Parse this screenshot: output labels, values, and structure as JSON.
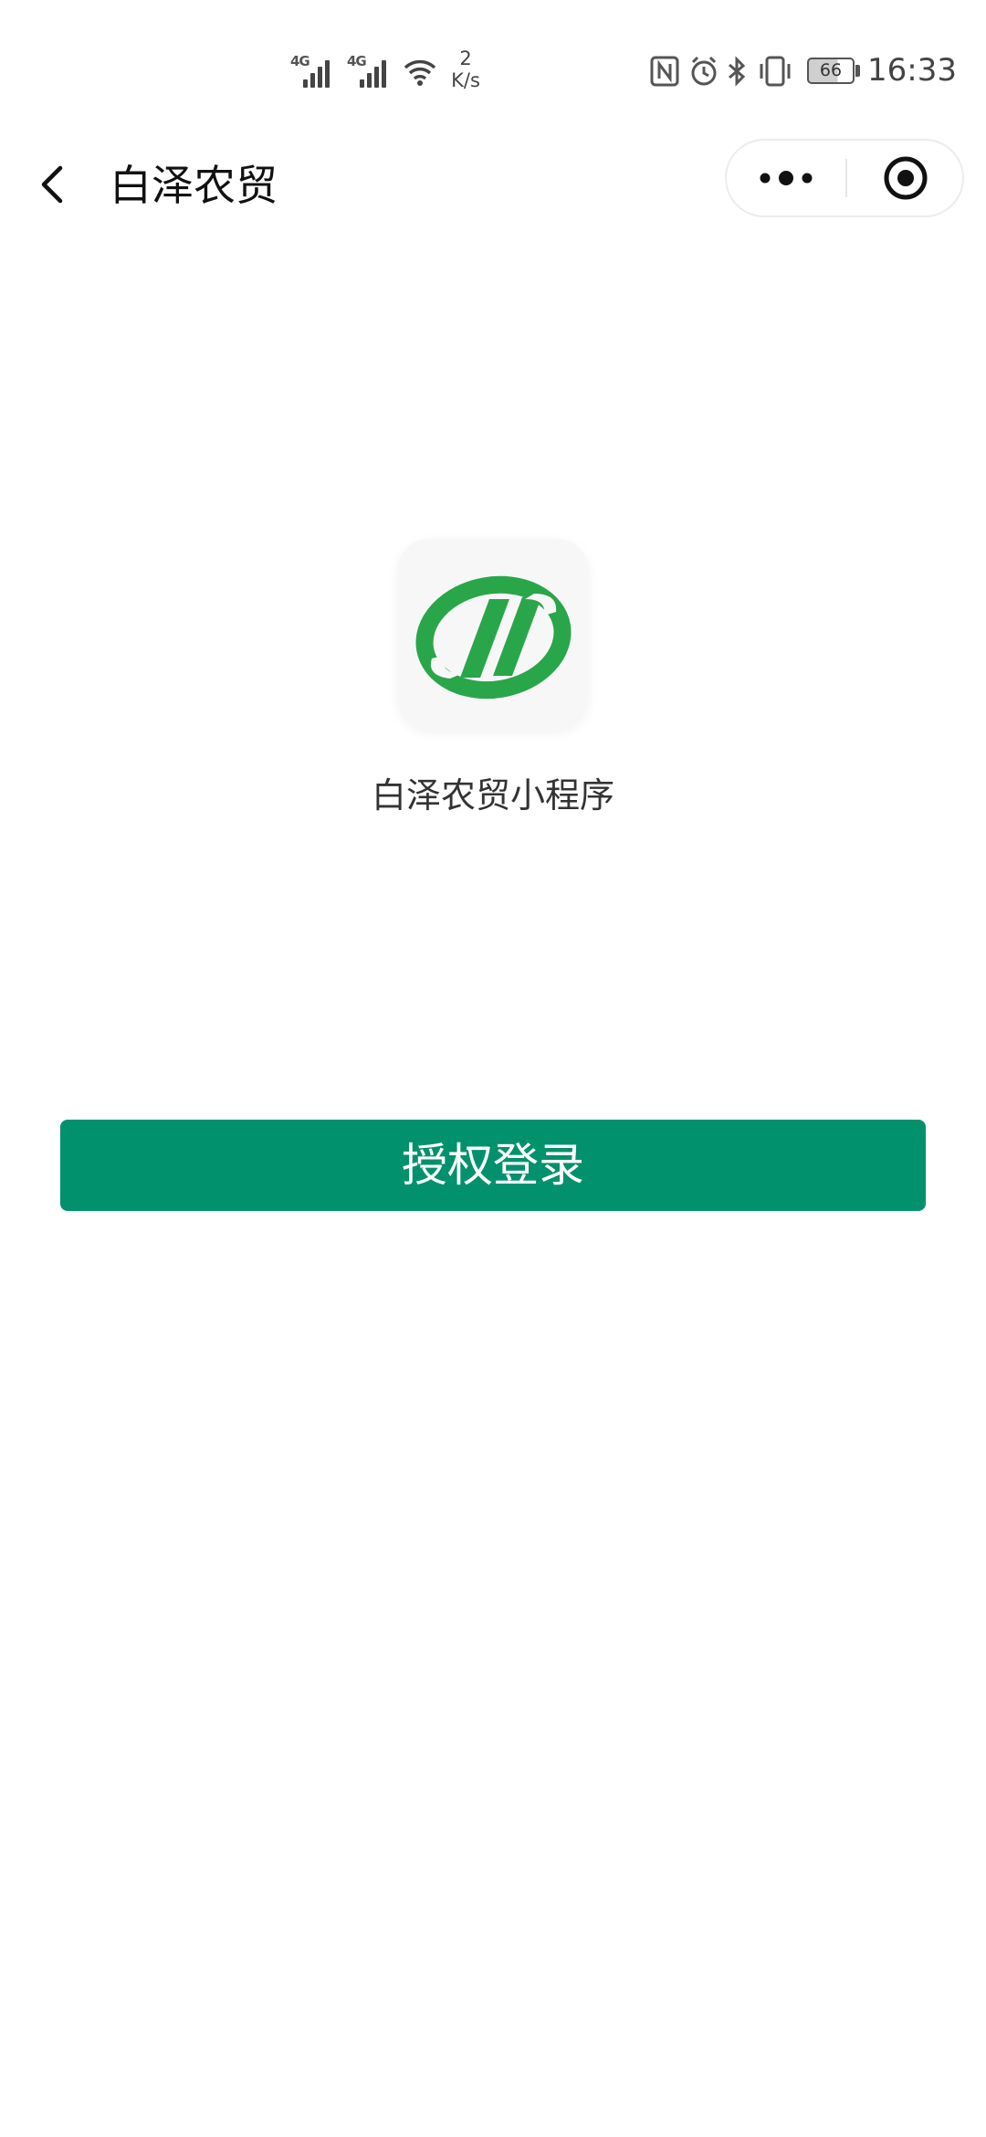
{
  "status_bar": {
    "network_1": "4G",
    "network_2": "4G",
    "speed_value": "2",
    "speed_unit": "K/s",
    "battery_level": "66",
    "time": "16:33",
    "icons": [
      "signal-icon",
      "signal-icon",
      "wifi-icon",
      "nfc-icon",
      "alarm-icon",
      "bluetooth-icon",
      "vibrate-icon",
      "battery-icon"
    ]
  },
  "nav": {
    "title": "白泽农贸",
    "back_icon": "chevron-left-icon",
    "more_icon": "more-dots-icon",
    "close_icon": "target-circle-icon"
  },
  "main": {
    "app_name": "白泽农贸小程序",
    "login_button": "授权登录"
  },
  "colors": {
    "primary_button": "#01916d",
    "logo_green": "#2aa64a",
    "background": "#ffffff"
  }
}
